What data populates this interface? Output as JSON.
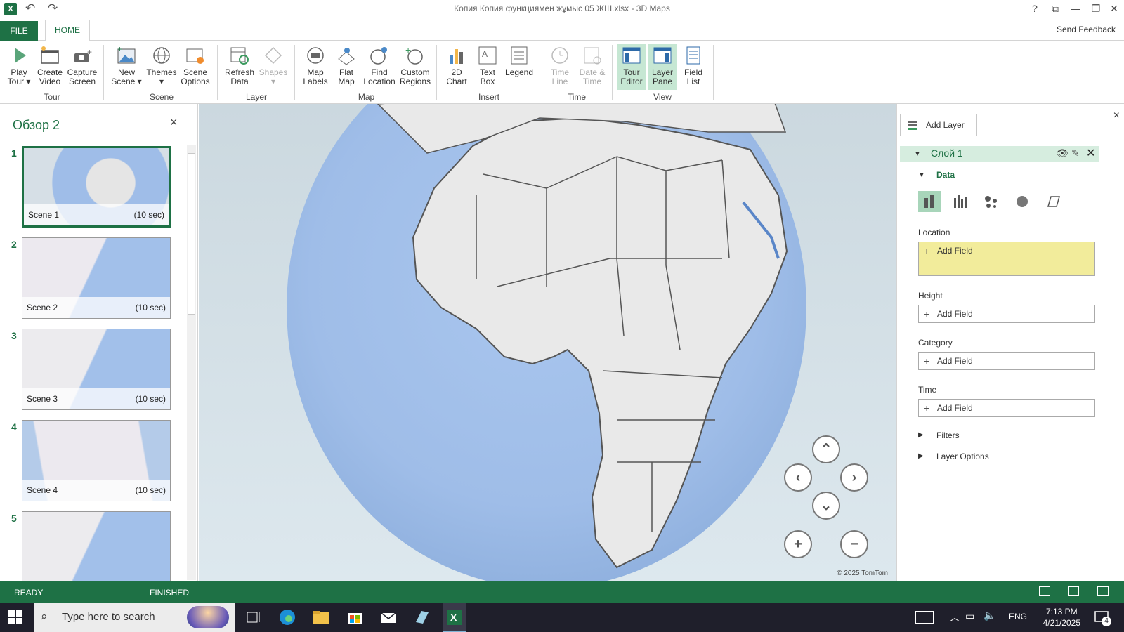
{
  "window": {
    "title": "Копия Копия функциямен жұмыс 05 ЖШ.xlsx - 3D Maps",
    "app_icon": "X",
    "help": "?",
    "controls": [
      "restore-down-icon",
      "minimize-icon",
      "maximize-icon",
      "close-icon"
    ]
  },
  "tabs": {
    "file": "FILE",
    "home": "HOME",
    "send_feedback": "Send Feedback"
  },
  "ribbon": {
    "groups": {
      "tour": "Tour",
      "scene": "Scene",
      "layer": "Layer",
      "map": "Map",
      "insert": "Insert",
      "time": "Time",
      "view": "View"
    },
    "buttons": {
      "play_tour": "Play\nTour ▾",
      "create_video": "Create\nVideo",
      "capture_screen": "Capture\nScreen",
      "new_scene": "New\nScene ▾",
      "themes": "Themes\n▾",
      "scene_options": "Scene\nOptions",
      "refresh_data": "Refresh\nData",
      "shapes": "Shapes\n▾",
      "map_labels": "Map\nLabels",
      "flat_map": "Flat\nMap",
      "find_location": "Find\nLocation",
      "custom_regions": "Custom\nRegions",
      "chart_2d": "2D\nChart",
      "text_box": "Text\nBox",
      "legend": "Legend",
      "time_line": "Time\nLine",
      "date_time": "Date &\nTime",
      "tour_editor": "Tour\nEditor",
      "layer_pane": "Layer\nPane",
      "field_list": "Field\nList"
    }
  },
  "tour": {
    "title": "Обзор 2",
    "close": "×",
    "scenes": [
      {
        "num": "1",
        "name": "Scene 1",
        "duration": "(10 sec)"
      },
      {
        "num": "2",
        "name": "Scene 2",
        "duration": "(10 sec)"
      },
      {
        "num": "3",
        "name": "Scene 3",
        "duration": "(10 sec)"
      },
      {
        "num": "4",
        "name": "Scene 4",
        "duration": "(10 sec)"
      },
      {
        "num": "5",
        "name": "",
        "duration": ""
      }
    ]
  },
  "map": {
    "copyright": "© 2025 TomTom",
    "nav": {
      "up": "⌃",
      "left": "‹",
      "right": "›",
      "down": "⌄",
      "zoom_in": "+",
      "zoom_out": "−"
    }
  },
  "layer_pane": {
    "add_layer": "Add Layer",
    "close": "×",
    "layer_name": "Слой 1",
    "data_section": "Data",
    "location_label": "Location",
    "height_label": "Height",
    "category_label": "Category",
    "time_label": "Time",
    "add_field": "Add Field",
    "filters": "Filters",
    "layer_options": "Layer Options"
  },
  "status": {
    "ready": "READY",
    "finished": "FINISHED"
  },
  "taskbar": {
    "search_placeholder": "Type here to search",
    "lang": "ENG",
    "time": "7:13 PM",
    "date": "4/21/2025",
    "notifications": "4"
  },
  "colors": {
    "accent": "#1e7145",
    "layer_header": "#d6eddf",
    "location_highlight": "#f2ec9b",
    "ocean": "#a2c0ea"
  }
}
